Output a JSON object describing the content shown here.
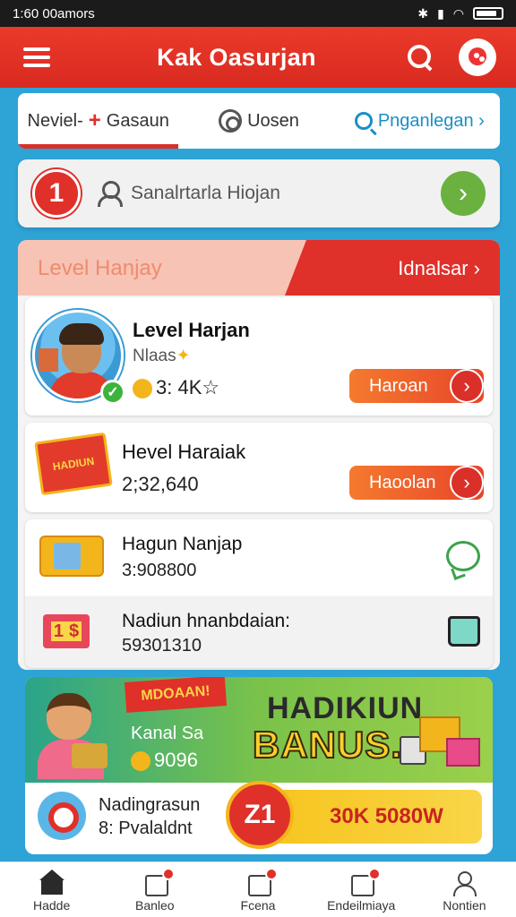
{
  "status_bar": {
    "time": "1:60 00amors"
  },
  "app_bar": {
    "title": "Kak Oasurjan"
  },
  "tabs": [
    {
      "label": "Neviel-",
      "label2": "Gasaun",
      "active": true
    },
    {
      "label": "Uosen"
    },
    {
      "label": "Pnganlegan ›"
    }
  ],
  "search_row": {
    "badge": "1",
    "text": "Sanalrtarla Hiojan",
    "go": "›"
  },
  "panel": {
    "header_left": "Level Hanjay",
    "header_right": "Idnalsar ›",
    "card1": {
      "title": "Level Harjan",
      "sub": "Nlaas",
      "value": "3: 4K",
      "button": "Haroan",
      "chev": "›"
    },
    "card2": {
      "sign_text": "HADIUN",
      "title": "Hevel Haraiak",
      "value": "2;32,640",
      "button": "Haoolan",
      "chev": "›"
    },
    "card3": {
      "title": "Hagun Nanjap",
      "value": "3:908800"
    },
    "card4": {
      "ticket": "1",
      "ticket2": "$",
      "title": "Nadiun hnanbdaian:",
      "value": "59301310"
    }
  },
  "promo": {
    "banner": "MDOAAN!",
    "small1": "Kanal Sa",
    "small2": "9096",
    "big1": "HADIKIUN",
    "big2": "BANUS.",
    "bottom1": "Nadingrasun",
    "bottom2": "8: Pvalaldnt",
    "cta_badge": "Z1",
    "cta_label": "30K 5080W"
  },
  "bottom_nav": [
    {
      "label": "Hadde"
    },
    {
      "label": "Banleo"
    },
    {
      "label": "Fcena"
    },
    {
      "label": "Endeilmiaya"
    },
    {
      "label": "Nontien"
    }
  ]
}
